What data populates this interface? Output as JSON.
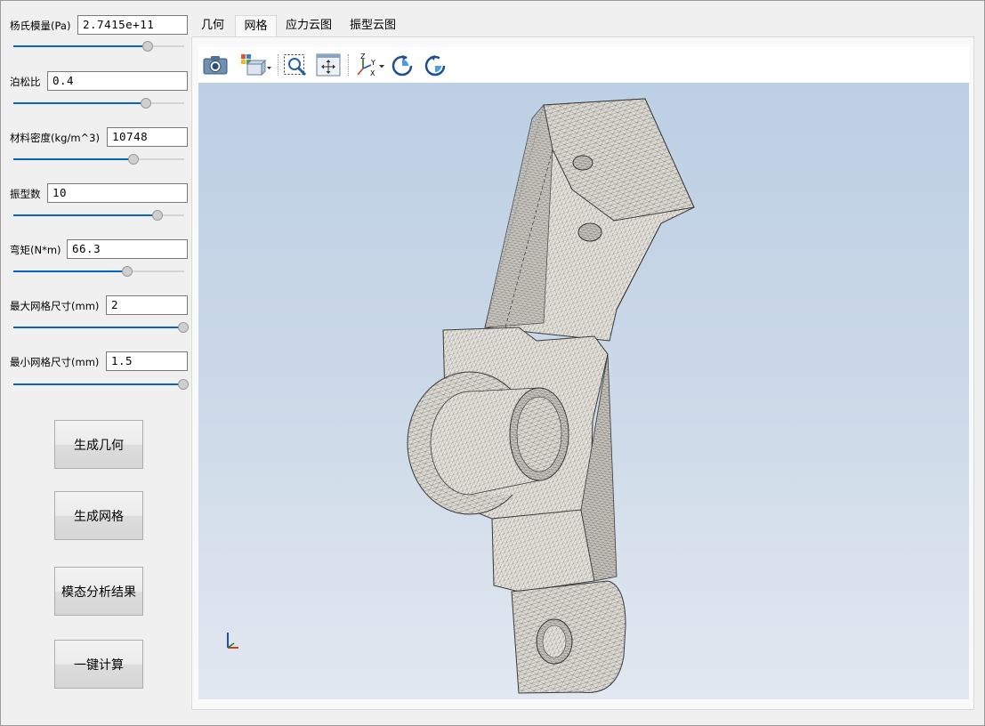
{
  "params": [
    {
      "label": "杨氏模量(Pa)",
      "value": "2.7415e+11",
      "slider": 0.78
    },
    {
      "label": "泊松比",
      "value": "0.4",
      "slider": 0.77
    },
    {
      "label": "材料密度(kg/m^3)",
      "value": "10748",
      "slider": 0.7
    },
    {
      "label": "振型数",
      "value": "10",
      "slider": 0.84
    },
    {
      "label": "弯矩(N*m)",
      "value": "66.3",
      "slider": 0.66
    },
    {
      "label": "最大网格尺寸(mm)",
      "value": "2",
      "slider": 0.99
    },
    {
      "label": "最小网格尺寸(mm)",
      "value": "1.5",
      "slider": 0.99
    }
  ],
  "buttons": {
    "generate_geometry": "生成几何",
    "generate_mesh": "生成网格",
    "modal_results": "模态分析结果",
    "one_click": "一键计算"
  },
  "tabs": [
    {
      "label": "几何",
      "active": false
    },
    {
      "label": "网格",
      "active": true
    },
    {
      "label": "应力云图",
      "active": false
    },
    {
      "label": "振型云图",
      "active": false
    }
  ],
  "toolbar": {
    "icons": [
      "camera-icon",
      "view-cube-icon",
      "zoom-box-icon",
      "fit-all-icon",
      "axes-view-icon",
      "rotate-cw-icon",
      "rotate-ccw-icon"
    ],
    "axis_labels": {
      "z": "Z",
      "y": "Y",
      "x": "X"
    }
  },
  "colors": {
    "accent": "#0a64c8",
    "viewport_top": "#bccfe4",
    "viewport_bottom": "#e2e8f1",
    "mesh": "#3c3c3c",
    "part": "#dedbd4"
  }
}
